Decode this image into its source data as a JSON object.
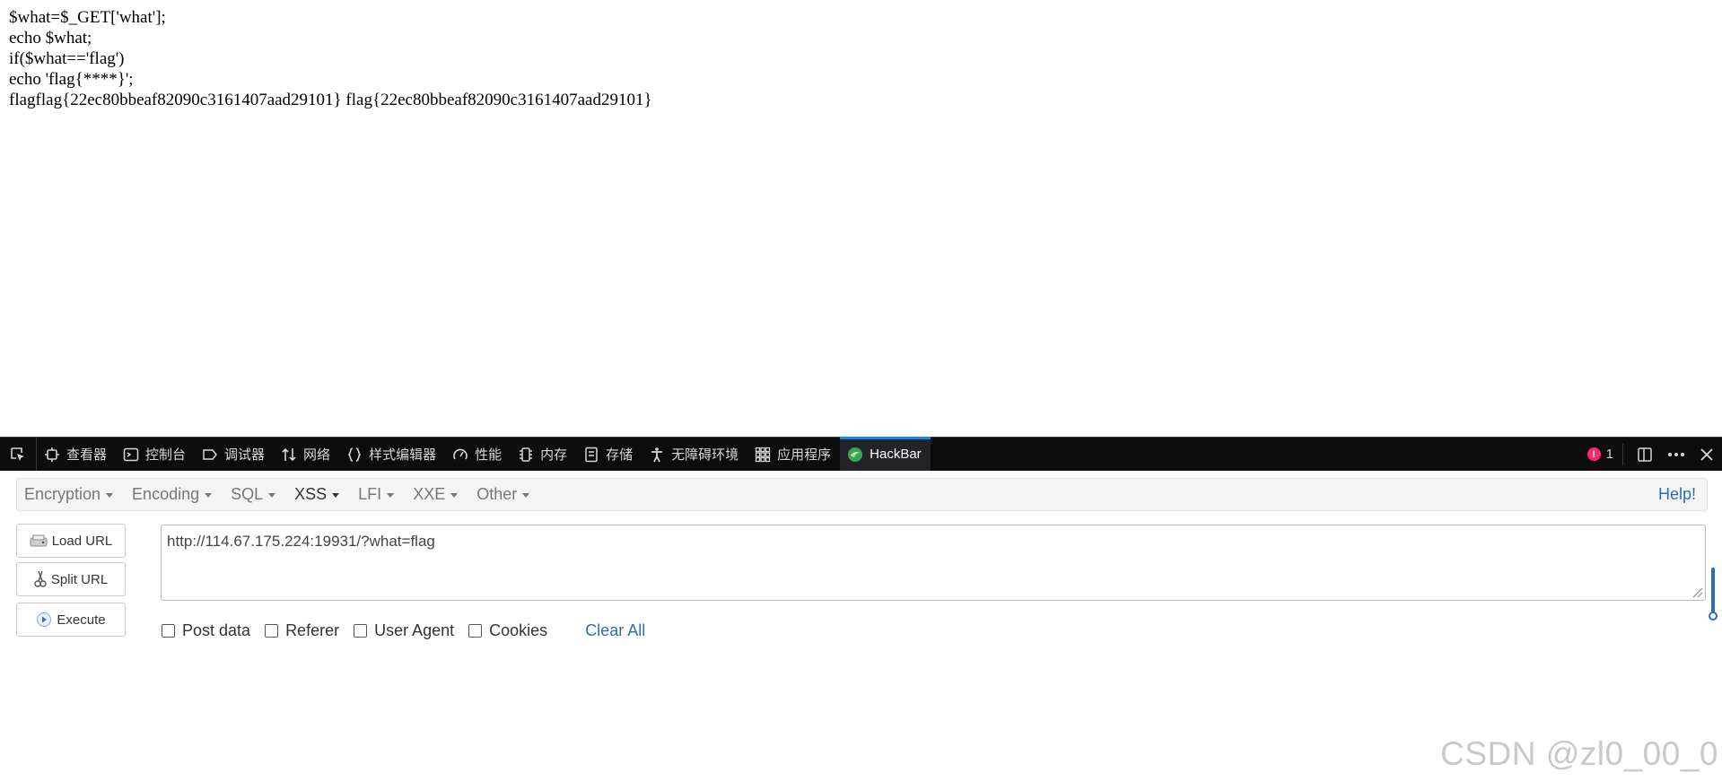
{
  "page": {
    "lines": [
      "$what=$_GET['what'];",
      "echo $what;",
      "if($what=='flag')",
      "echo 'flag{****}';",
      "flagflag{22ec80bbeaf82090c3161407aad29101} flag{22ec80bbeaf82090c3161407aad29101}"
    ]
  },
  "devtools": {
    "tabs": [
      {
        "label": "查看器",
        "icon": "inspector-icon"
      },
      {
        "label": "控制台",
        "icon": "console-icon"
      },
      {
        "label": "调试器",
        "icon": "debugger-icon"
      },
      {
        "label": "网络",
        "icon": "network-icon"
      },
      {
        "label": "样式编辑器",
        "icon": "style-editor-icon"
      },
      {
        "label": "性能",
        "icon": "performance-icon"
      },
      {
        "label": "内存",
        "icon": "memory-icon"
      },
      {
        "label": "存储",
        "icon": "storage-icon"
      },
      {
        "label": "无障碍环境",
        "icon": "accessibility-icon"
      },
      {
        "label": "应用程序",
        "icon": "application-icon"
      },
      {
        "label": "HackBar",
        "icon": "hackbar-icon"
      }
    ],
    "active_tab": "HackBar",
    "error_count": "1",
    "accent_color": "#0a84ff"
  },
  "hackbar": {
    "menus": [
      "Encryption",
      "Encoding",
      "SQL",
      "XSS",
      "LFI",
      "XXE",
      "Other"
    ],
    "active_menu": "XSS",
    "help": "Help!",
    "buttons": {
      "load_url": "Load URL",
      "split_url": "Split URL",
      "execute": "Execute"
    },
    "url": "http://114.67.175.224:19931/?what=flag",
    "options": [
      "Post data",
      "Referer",
      "User Agent",
      "Cookies"
    ],
    "clear_all": "Clear All",
    "link_color": "#2a6fb5"
  },
  "watermark": "CSDN @zl0_00_0"
}
